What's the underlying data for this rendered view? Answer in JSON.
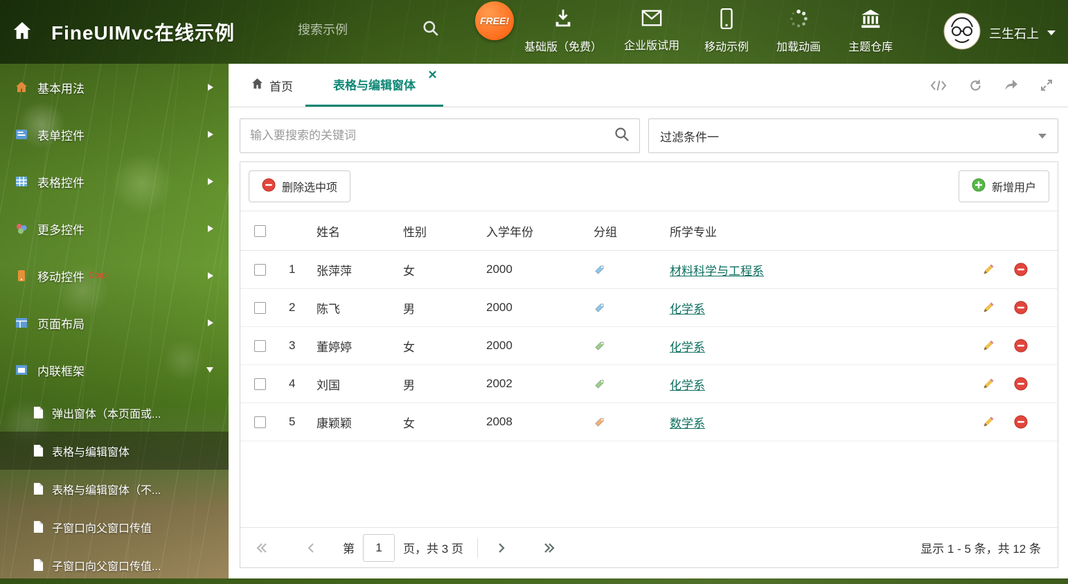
{
  "header": {
    "title": "FineUIMvc在线示例",
    "search_placeholder": "搜索示例",
    "free_badge": "FREE!",
    "nav_items": [
      {
        "label": "基础版（免费）",
        "icon": "download-icon"
      },
      {
        "label": "企业版试用",
        "icon": "mail-icon"
      },
      {
        "label": "移动示例",
        "icon": "mobile-icon"
      },
      {
        "label": "加载动画",
        "icon": "spinner-icon"
      },
      {
        "label": "主题仓库",
        "icon": "bank-icon"
      }
    ],
    "user_name": "三生石上"
  },
  "sidebar": {
    "items": [
      {
        "label": "基本用法"
      },
      {
        "label": "表单控件"
      },
      {
        "label": "表格控件"
      },
      {
        "label": "更多控件"
      },
      {
        "label": "移动控件",
        "badge": "Corp."
      },
      {
        "label": "页面布局"
      },
      {
        "label": "内联框架",
        "expanded": true
      }
    ],
    "subitems": [
      {
        "label": "弹出窗体（本页面或..."
      },
      {
        "label": "表格与编辑窗体",
        "active": true
      },
      {
        "label": "表格与编辑窗体（不..."
      },
      {
        "label": "子窗口向父窗口传值"
      },
      {
        "label": "子窗口向父窗口传值..."
      }
    ]
  },
  "tabs": {
    "home_label": "首页",
    "active_label": "表格与编辑窗体"
  },
  "filters": {
    "search_placeholder": "输入要搜索的关键词",
    "filter_value": "过滤条件一"
  },
  "toolbar": {
    "delete_label": "删除选中项",
    "add_label": "新增用户"
  },
  "table": {
    "columns": [
      "姓名",
      "性别",
      "入学年份",
      "分组",
      "所学专业"
    ],
    "rows": [
      {
        "index": "1",
        "name": "张萍萍",
        "gender": "女",
        "year": "2000",
        "tag": "blue",
        "major": "材料科学与工程系"
      },
      {
        "index": "2",
        "name": "陈飞",
        "gender": "男",
        "year": "2000",
        "tag": "blue",
        "major": "化学系"
      },
      {
        "index": "3",
        "name": "董婷婷",
        "gender": "女",
        "year": "2000",
        "tag": "green",
        "major": "化学系"
      },
      {
        "index": "4",
        "name": "刘国",
        "gender": "男",
        "year": "2002",
        "tag": "green",
        "major": "化学系"
      },
      {
        "index": "5",
        "name": "康颖颖",
        "gender": "女",
        "year": "2008",
        "tag": "orange",
        "major": "数学系"
      }
    ]
  },
  "pagination": {
    "prefix": "第",
    "current_page": "1",
    "suffix": "页，共 3 页",
    "summary": "显示 1 - 5 条，共 12 条"
  },
  "colors": {
    "accent_teal": "#0e8674",
    "link": "#0c6e5f",
    "tag_blue": "#8cc8ec",
    "tag_green": "#9ccf8a",
    "tag_orange": "#f4b276",
    "delete_red": "#e2453c",
    "add_green": "#57b846",
    "free_badge_orange": "#ff6b1a"
  }
}
